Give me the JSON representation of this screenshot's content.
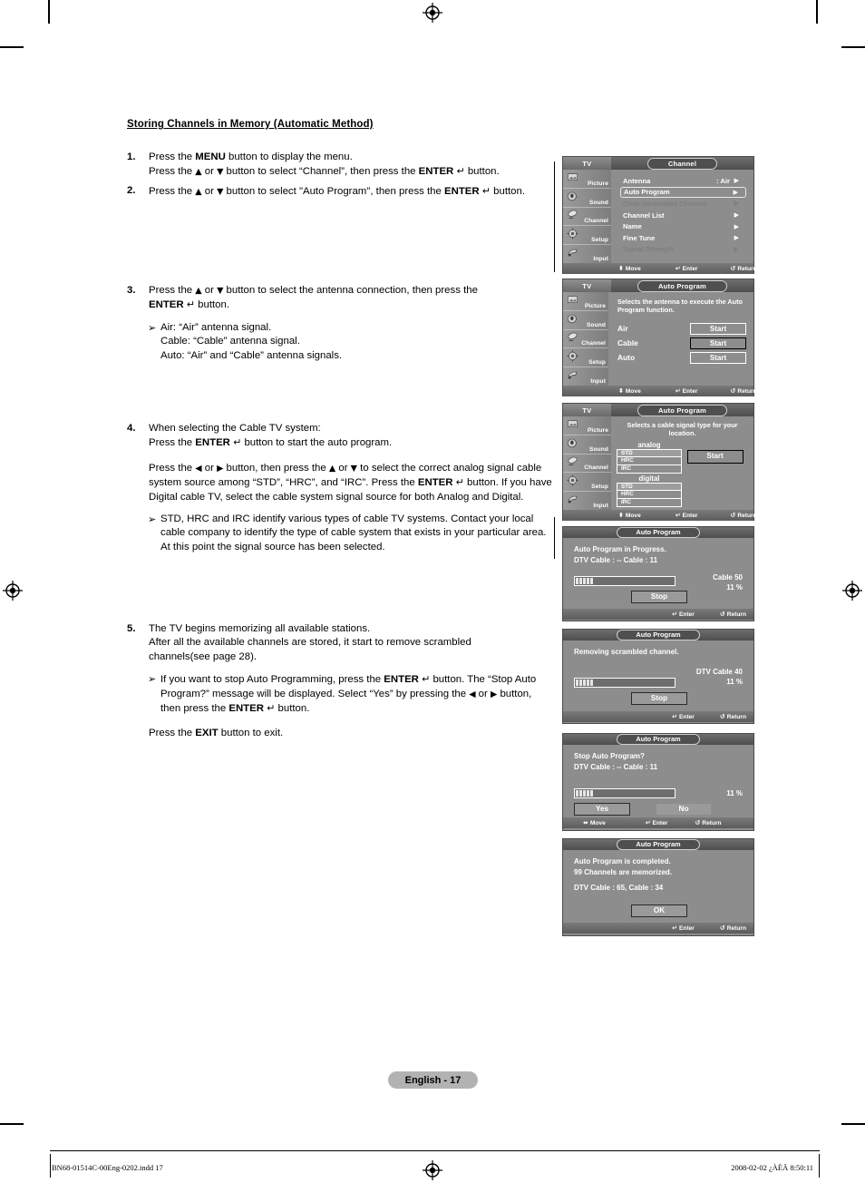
{
  "document": {
    "heading": "Storing Channels in Memory (Automatic Method)",
    "page_label": "English - 17",
    "footer_left": "BN68-01514C-00Eng-0202.indd   17",
    "footer_right": "2008-02-02   ¿ÀÈÄ 8:50:11"
  },
  "steps": [
    {
      "num": "1.",
      "lines": [
        "Press the MENU button to display the menu.",
        "Press the ▲ or ▼ button to select “Channel”, then press the ENTER ↵ button."
      ]
    },
    {
      "num": "2.",
      "lines": [
        "Press the ▲ or ▼ button to select \"Auto Program\", then press the ENTER ↵ button."
      ]
    },
    {
      "num": "3.",
      "lines": [
        "Press the ▲ or ▼ button to select the antenna connection, then press the",
        "ENTER ↵ button."
      ],
      "note": [
        "Air: “Air” antenna signal.",
        "Cable: “Cable” antenna signal.",
        "Auto: “Air” and “Cable” antenna signals."
      ]
    },
    {
      "num": "4.",
      "lines": [
        "When selecting the Cable TV system:",
        "Press the ENTER ↵ button to start the auto program."
      ],
      "para": [
        "Press the ◀ or ▶ button, then press the ▲ or ▼ to select the correct analog signal",
        "cable system source among “STD”, “HRC”, and “IRC”. Press the ENTER ↵ button.",
        "If you have Digital cable TV, select the cable system signal source for both Analog",
        "and Digital."
      ],
      "note": [
        "STD, HRC and IRC identify various types of cable TV systems. Contact your",
        "local cable company to identify the type of cable system that exists in your",
        "particular area. At this point the signal source has been selected."
      ]
    },
    {
      "num": "5.",
      "lines": [
        "The TV begins memorizing all available stations.",
        "After all the available channels are stored, it start to remove scrambled",
        "channels(see page 28)."
      ],
      "note": [
        "If you want to stop Auto Programming, press the ENTER ↵ button. The “Stop",
        "Auto Program?” message will be displayed. Select “Yes” by pressing the ◀ or ▶",
        "button, then press the ENTER ↵ button."
      ],
      "tail": "Press the EXIT button to exit."
    }
  ],
  "osd": {
    "tv_tab": "TV",
    "sidebar": [
      {
        "label": "Picture",
        "icon": "picture-icon"
      },
      {
        "label": "Sound",
        "icon": "sound-icon"
      },
      {
        "label": "Channel",
        "icon": "channel-icon"
      },
      {
        "label": "Setup",
        "icon": "setup-icon"
      },
      {
        "label": "Input",
        "icon": "input-icon"
      }
    ],
    "footer": {
      "move": "Move",
      "enter": "Enter",
      "return": "Return"
    },
    "panel1": {
      "title": "Channel",
      "rows": [
        {
          "label": "Antenna",
          "value": ": Air",
          "state": "normal"
        },
        {
          "label": "Auto Program",
          "value": "",
          "state": "selected"
        },
        {
          "label": "Clear Scrambled Channel",
          "value": "",
          "state": "dim"
        },
        {
          "label": "Channel List",
          "value": "",
          "state": "normal"
        },
        {
          "label": "Name",
          "value": "",
          "state": "normal"
        },
        {
          "label": "Fine Tune",
          "value": "",
          "state": "normal"
        },
        {
          "label": "Signal Strength",
          "value": "",
          "state": "dim"
        }
      ]
    },
    "panel2": {
      "title": "Auto Program",
      "description": "Selects the antenna to execute the Auto Program function.",
      "options": [
        {
          "label": "Air",
          "button": "Start",
          "highlighted": false
        },
        {
          "label": "Cable",
          "button": "Start",
          "highlighted": true
        },
        {
          "label": "Auto",
          "button": "Start",
          "highlighted": false
        }
      ]
    },
    "panel3": {
      "title": "Auto Program",
      "description": "Selects a cable signal type for your location.",
      "analog_label": "analog",
      "analog_options": [
        "STD",
        "HRC",
        "IRC"
      ],
      "digital_label": "digital",
      "digital_options": [
        "STD",
        "HRC",
        "IRC"
      ],
      "button": "Start"
    },
    "panel4": {
      "title": "Auto Program",
      "line1": "Auto Program in Progress.",
      "line2": "DTV Cable : --        Cable : 11",
      "stat1": "Cable   50",
      "stat2": "11    %",
      "button": "Stop",
      "progress_segments": 5,
      "footer": {
        "enter": "Enter",
        "return": "Return"
      }
    },
    "panel5": {
      "title": "Auto Program",
      "line1": "Removing scrambled channel.",
      "stat1": "DTV Cable 40",
      "stat2": "11    %",
      "button": "Stop",
      "progress_segments": 5,
      "footer": {
        "enter": "Enter",
        "return": "Return"
      }
    },
    "panel6": {
      "title": "Auto Program",
      "line1": "Stop Auto Program?",
      "line2": "DTV Cable : --        Cable : 11",
      "stat2": "11    %",
      "yes": "Yes",
      "no": "No",
      "progress_segments": 5,
      "footer": {
        "move": "Move",
        "enter": "Enter",
        "return": "Return"
      }
    },
    "panel7": {
      "title": "Auto Program",
      "line1": "Auto Program is completed.",
      "line2": "99 Channels are memorized.",
      "line3": "DTV Cable : 65, Cable : 34",
      "button": "OK",
      "footer": {
        "enter": "Enter",
        "return": "Return"
      }
    }
  }
}
